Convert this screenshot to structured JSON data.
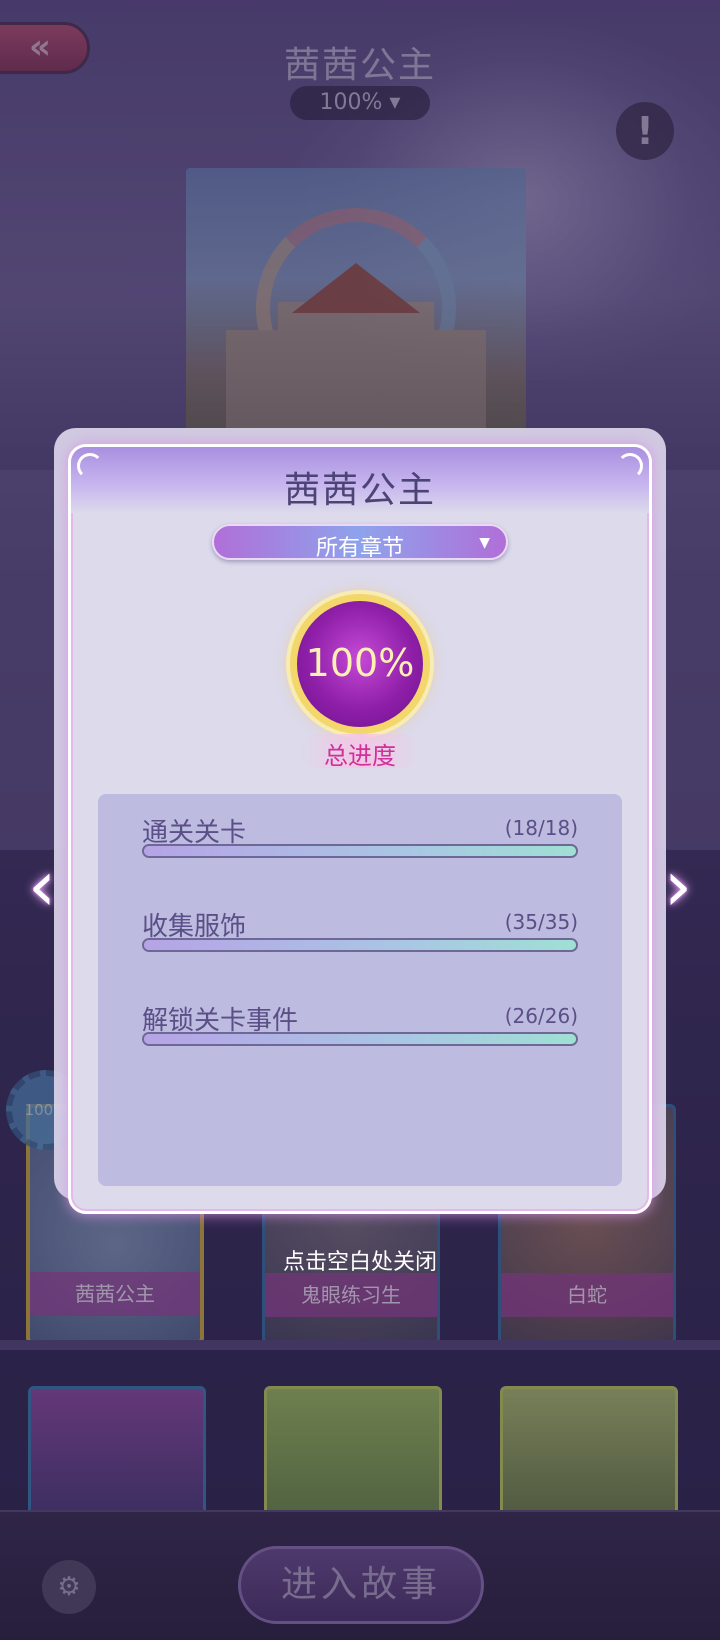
{
  "header": {
    "back_icon": "«",
    "title": "茜茜公主",
    "percent_select": "100% ▾",
    "info_icon": "!"
  },
  "shelf": {
    "badge": "100%",
    "cards": [
      {
        "label": "茜茜公主"
      },
      {
        "label": "鬼眼练习生"
      },
      {
        "label": "白蛇"
      }
    ]
  },
  "bottom": {
    "settings_icon": "⚙",
    "enter_label": "进入故事"
  },
  "modal": {
    "title": "茜茜公主",
    "chapter_select": "所有章节",
    "chapter_caret": "▼",
    "progress_value": "100%",
    "progress_fraction": 1.0,
    "total_label": "总进度",
    "stats": [
      {
        "label": "通关关卡",
        "count": "(18/18)",
        "fraction": 1.0
      },
      {
        "label": "收集服饰",
        "count": "(35/35)",
        "fraction": 1.0
      },
      {
        "label": "解锁关卡事件",
        "count": "(26/26)",
        "fraction": 1.0
      }
    ],
    "left_arrow": "‹",
    "right_arrow": "›",
    "close_hint": "点击空白处关闭"
  },
  "colors": {
    "accent_gold": "#f3d76a",
    "title_purple": "#4d4476",
    "total_pink": "#d12f9a"
  }
}
